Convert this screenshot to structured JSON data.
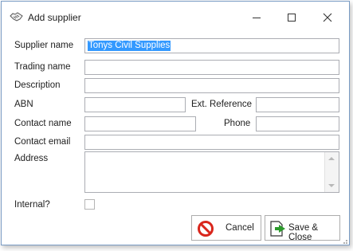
{
  "window": {
    "title": "Add supplier"
  },
  "form": {
    "supplier_name_label": "Supplier name",
    "supplier_name_value": "Tonys Civil Supplies",
    "trading_name_label": "Trading name",
    "trading_name_value": "",
    "description_label": "Description",
    "description_value": "",
    "abn_label": "ABN",
    "abn_value": "",
    "ext_reference_label": "Ext. Reference",
    "ext_reference_value": "",
    "contact_name_label": "Contact name",
    "contact_name_value": "",
    "phone_label": "Phone",
    "phone_value": "",
    "contact_email_label": "Contact email",
    "contact_email_value": "",
    "address_label": "Address",
    "address_value": "",
    "internal_label": "Internal?",
    "internal_checked": false
  },
  "buttons": {
    "cancel_label": "Cancel",
    "save_close_label": "Save & Close"
  },
  "colors": {
    "selection": "#3399ff",
    "border": "#abadb3",
    "cancel_icon": "#d9261c",
    "save_icon": "#2c9a2c"
  },
  "icons": {
    "title": "handshake-icon",
    "cancel": "no-entry-icon",
    "save": "exit-arrow-icon"
  }
}
